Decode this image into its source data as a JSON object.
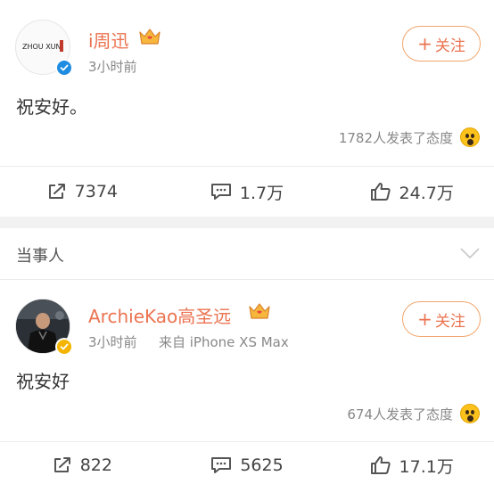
{
  "post1": {
    "avatar_label": "ZHOU XUN",
    "username": "i周迅",
    "time": "3小时前",
    "follow_label": "关注",
    "follow_plus": "+",
    "content": "祝安好。",
    "reaction_text": "1782人发表了态度",
    "repost_count": "7374",
    "comment_count": "1.7万",
    "like_count": "24.7万"
  },
  "section": {
    "title": "当事人"
  },
  "post2": {
    "username": "ArchieKao高圣远",
    "time": "3小时前",
    "source": "来自 iPhone XS Max",
    "follow_label": "关注",
    "follow_plus": "+",
    "content": "祝安好",
    "reaction_text": "674人发表了态度",
    "repost_count": "822",
    "comment_count": "5625",
    "like_count": "17.1万"
  },
  "colors": {
    "accent": "#eb7350",
    "follow_border": "#f2a66d",
    "verified_blue": "#1e8ce0",
    "verified_gold": "#f4b400",
    "gap": "#f2f2f2"
  },
  "icons": {
    "repost": "repost-icon",
    "comment": "comment-icon",
    "like": "thumbs-up-icon",
    "reaction": "wow-emoji-icon",
    "crown": "vip-crown-icon",
    "chevron": "chevron-down-icon"
  }
}
